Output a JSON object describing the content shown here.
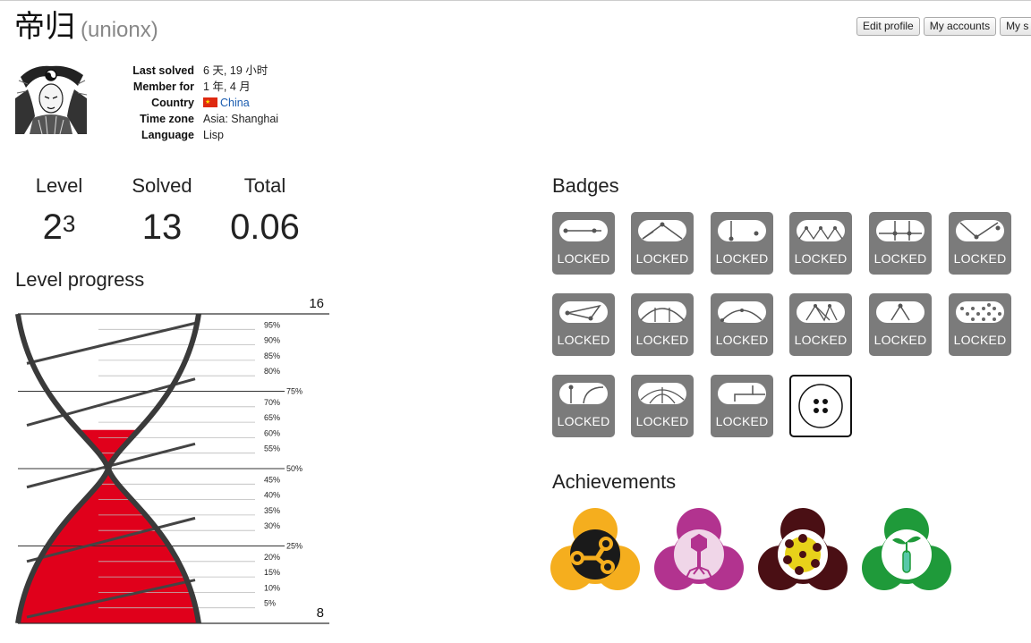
{
  "profile": {
    "name": "帝归",
    "handle": "(unionx)",
    "buttons": [
      "Edit profile",
      "My accounts",
      "My s"
    ],
    "info": [
      {
        "key": "Last solved",
        "value": "6 天, 19 小时"
      },
      {
        "key": "Member for",
        "value": "1 年, 4 月"
      },
      {
        "key": "Country",
        "value": "China"
      },
      {
        "key": "Time zone",
        "value": "Asia: Shanghai"
      },
      {
        "key": "Language",
        "value": "Lisp"
      }
    ]
  },
  "stats": {
    "level_label": "Level",
    "level_base": "2",
    "level_exp": "3",
    "solved_label": "Solved",
    "solved_value": "13",
    "total_label": "Total",
    "total_value": "0.06"
  },
  "progress": {
    "heading": "Level progress",
    "top_value": "16",
    "bottom_value": "8",
    "fill_fraction": 0.625,
    "ticks": [
      "95%",
      "90%",
      "85%",
      "80%",
      "75%",
      "70%",
      "65%",
      "60%",
      "55%",
      "50%",
      "45%",
      "40%",
      "35%",
      "30%",
      "25%",
      "20%",
      "15%",
      "10%",
      "5%"
    ]
  },
  "badges": {
    "heading": "Badges",
    "locked_label": "LOCKED",
    "items": [
      {
        "name": "badge-1",
        "locked": true
      },
      {
        "name": "badge-2",
        "locked": true
      },
      {
        "name": "badge-3",
        "locked": true
      },
      {
        "name": "badge-4",
        "locked": true
      },
      {
        "name": "badge-5",
        "locked": true
      },
      {
        "name": "badge-6",
        "locked": true
      },
      {
        "name": "badge-7",
        "locked": true
      },
      {
        "name": "badge-8",
        "locked": true
      },
      {
        "name": "badge-9",
        "locked": true
      },
      {
        "name": "badge-10",
        "locked": true
      },
      {
        "name": "badge-11",
        "locked": true
      },
      {
        "name": "badge-12",
        "locked": true
      },
      {
        "name": "badge-13",
        "locked": true
      },
      {
        "name": "badge-14",
        "locked": true
      },
      {
        "name": "badge-15",
        "locked": true
      },
      {
        "name": "badge-16",
        "locked": false
      }
    ]
  },
  "achievements": {
    "heading": "Achievements",
    "items": [
      {
        "icon": "network-icon",
        "color": "#f5ae1e",
        "inner": "#1a1a1a"
      },
      {
        "icon": "bacteriophage-icon",
        "color": "#b2338f",
        "inner": "#f0d6e8"
      },
      {
        "icon": "cell-icon",
        "color": "#4a0f14",
        "inner": "#ffffff"
      },
      {
        "icon": "sprout-icon",
        "color": "#1f9a3a",
        "inner": "#ffffff"
      }
    ]
  },
  "colors": {
    "accent_link": "#1a5cb0",
    "progress_fill": "#e0001b",
    "badge_locked": "#7b7b7b"
  }
}
